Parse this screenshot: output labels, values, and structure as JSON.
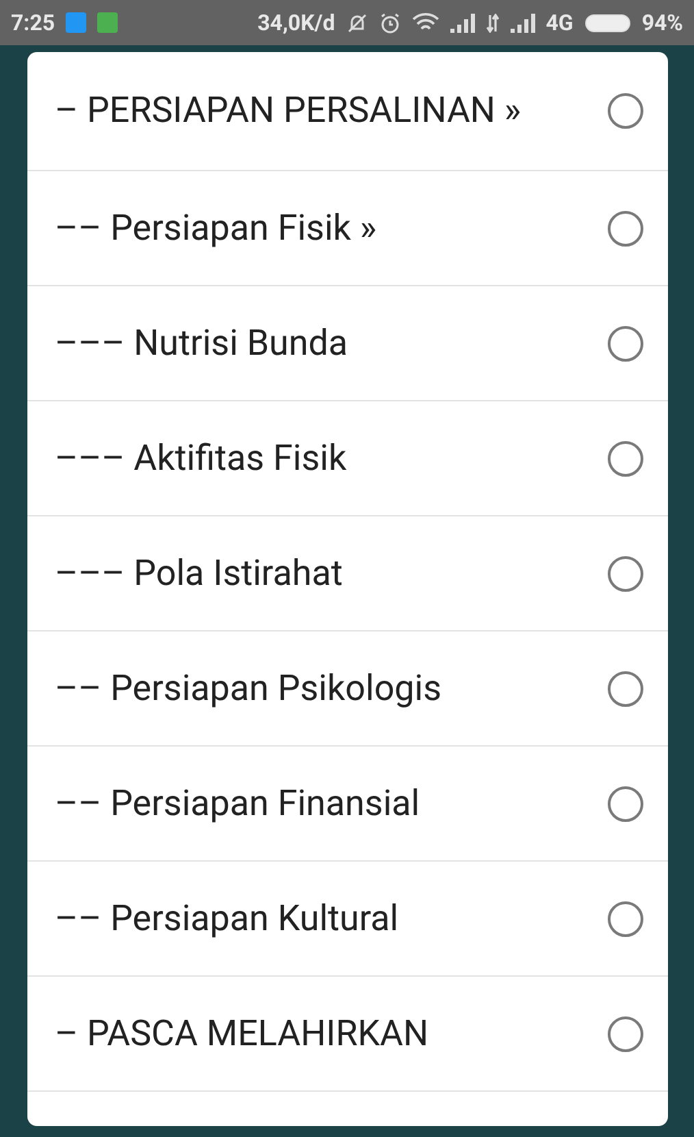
{
  "status_bar": {
    "time": "7:25",
    "speed": "34,0K/d",
    "network": "4G",
    "battery": "94%"
  },
  "options": [
    {
      "label": "– PERSIAPAN PERSALINAN »",
      "selected": false
    },
    {
      "label": "–– Persiapan Fisik »",
      "selected": false
    },
    {
      "label": "––– Nutrisi Bunda",
      "selected": false
    },
    {
      "label": "––– Aktifitas Fisik",
      "selected": false
    },
    {
      "label": "––– Pola Istirahat",
      "selected": false
    },
    {
      "label": "–– Persiapan Psikologis",
      "selected": false
    },
    {
      "label": "–– Persiapan Finansial",
      "selected": false
    },
    {
      "label": "–– Persiapan Kultural",
      "selected": false
    },
    {
      "label": "– PASCA MELAHIRKAN",
      "selected": false
    }
  ]
}
